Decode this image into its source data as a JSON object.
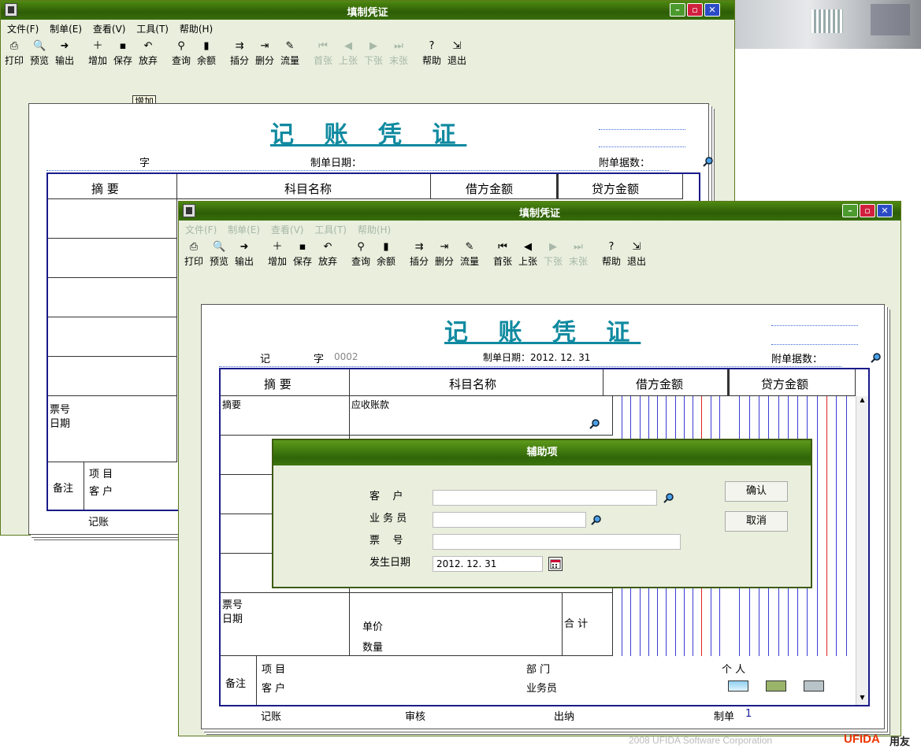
{
  "bg_window": {
    "title": "填制凭证",
    "menu": [
      "文件(F)",
      "制单(E)",
      "查看(V)",
      "工具(T)",
      "帮助(H)"
    ],
    "toolbar": [
      "打印",
      "预览",
      "输出",
      "增加",
      "保存",
      "放弃",
      "查询",
      "余额",
      "插分",
      "删分",
      "流量",
      "首张",
      "上张",
      "下张",
      "末张",
      "帮助",
      "退出"
    ],
    "tooltip": "增加",
    "voucher_title": "记 账 凭 证",
    "word_label": "字",
    "date_label": "制单日期：",
    "attach_label": "附单据数：",
    "col_summary": "摘 要",
    "col_subject": "科目名称",
    "col_debit": "借方金额",
    "col_credit": "贷方金额",
    "ticket_label": "票号",
    "date_row_label": "日期",
    "note_label": "备注",
    "project_label": "项  目",
    "customer_label": "客  户",
    "bookkeep_label": "记账"
  },
  "fg_window": {
    "title": "填制凭证",
    "menu": [
      "文件(F)",
      "制单(E)",
      "查看(V)",
      "工具(T)",
      "帮助(H)"
    ],
    "toolbar": [
      "打印",
      "预览",
      "输出",
      "增加",
      "保存",
      "放弃",
      "查询",
      "余额",
      "插分",
      "删分",
      "流量",
      "首张",
      "上张",
      "下张",
      "末张",
      "帮助",
      "退出"
    ],
    "voucher_title": "记 账 凭 证",
    "word_type": "记",
    "word_label": "字",
    "voucher_no": "0002",
    "date_label": "制单日期：2012. 12. 31",
    "attach_label": "附单据数：",
    "col_summary": "摘 要",
    "col_subject": "科目名称",
    "col_debit": "借方金额",
    "col_credit": "贷方金额",
    "row1_summary": "摘要",
    "row1_subject": "应收账款",
    "ticket_label": "票号",
    "date_row_label": "日期",
    "unit_price_label": "单价",
    "quantity_label": "数量",
    "total_label": "合 计",
    "note_label": "备注",
    "project_label": "项  目",
    "customer_label": "客  户",
    "dept_label": "部  门",
    "salesman_label": "业务员",
    "person_label": "个  人",
    "bookkeep_label": "记账",
    "audit_label": "审核",
    "cashier_label": "出纳",
    "maker_label": "制单",
    "maker_value": "1"
  },
  "dialog": {
    "title": "辅助项",
    "customer_label": "客    户",
    "salesman_label": "业 务 员",
    "ticket_label": "票    号",
    "occur_date_label": "发生日期",
    "customer_value": "",
    "salesman_value": "",
    "ticket_value": "",
    "occur_date_value": "2012. 12. 31",
    "ok_label": "确认",
    "cancel_label": "取消"
  },
  "footer": {
    "copyright": "2008 UFIDA Software Corporation",
    "logo": "UFIDA",
    "logo_cn": "用友"
  },
  "colors": {
    "title_green": "#2d5d06",
    "window_bg": "#e9eedd",
    "voucher_title": "#108aa0",
    "grid_border": "#1a1a8a",
    "red_line": "#e02020",
    "blue_line": "#3b3bd6"
  }
}
